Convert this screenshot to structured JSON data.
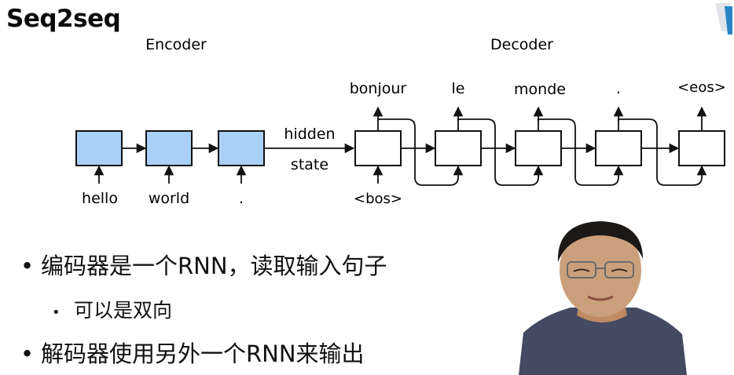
{
  "title": "Seq2seq",
  "diagram": {
    "encoder_label": "Encoder",
    "decoder_label": "Decoder",
    "encoder_inputs": [
      "hello",
      "world",
      "."
    ],
    "hidden_state_label": [
      "hidden",
      "state"
    ],
    "decoder_input": "<bos>",
    "decoder_outputs": [
      "bonjour",
      "le",
      "monde",
      ".",
      "<eos>"
    ],
    "colors": {
      "encoder_cell": "#aad0f8",
      "decoder_cell": "#ffffff",
      "stroke": "#111111"
    }
  },
  "bullets": [
    {
      "text": "编码器是一个RNN，读取输入句子",
      "level": 1
    },
    {
      "text": "可以是双向",
      "level": 2
    },
    {
      "text": "解码器使用另外一个RNN来输出",
      "level": 1
    }
  ]
}
